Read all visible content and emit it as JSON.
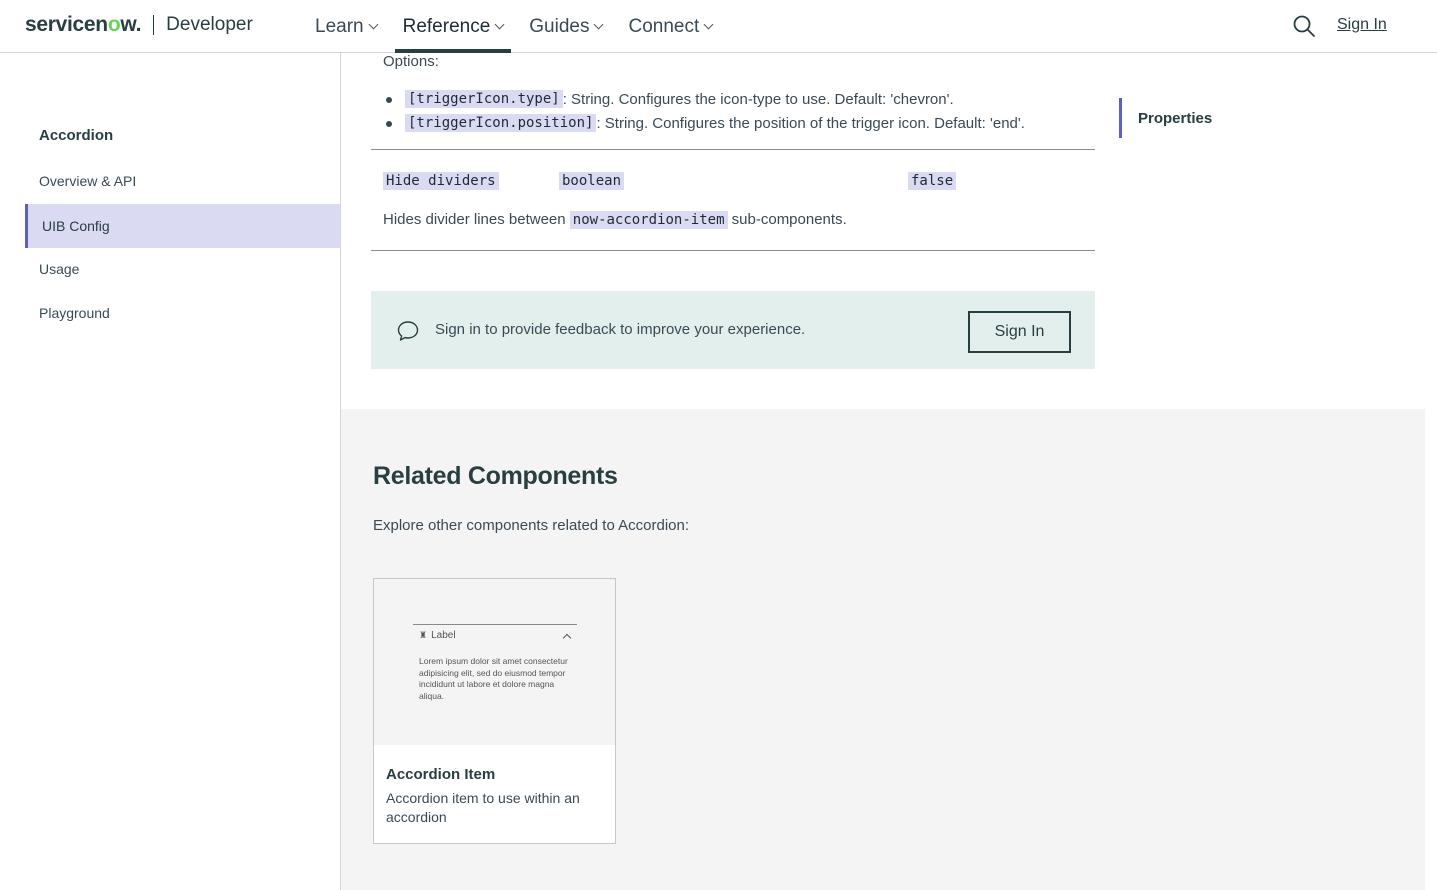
{
  "header": {
    "brand_prefix": "servicen",
    "brand_o": "o",
    "brand_suffix": "w.",
    "product": "Developer",
    "nav": [
      {
        "label": "Learn"
      },
      {
        "label": "Reference"
      },
      {
        "label": "Guides"
      },
      {
        "label": "Connect"
      }
    ],
    "active_nav": "Reference",
    "sign_in": "Sign In",
    "icons": {
      "search": "search-icon",
      "chevron": "chevron-down-icon"
    }
  },
  "sidebar": {
    "title": "Accordion",
    "items": [
      {
        "label": "Overview & API"
      },
      {
        "label": "UIB Config"
      },
      {
        "label": "Usage"
      },
      {
        "label": "Playground"
      }
    ],
    "active": "UIB Config"
  },
  "content": {
    "options_label": "Options:",
    "bullets": [
      {
        "code": "[triggerIcon.type]",
        "text": ": String. Configures the icon-type to use. Default: 'chevron'."
      },
      {
        "code": "[triggerIcon.position]",
        "text": ": String. Configures the position of the trigger icon. Default: 'end'."
      }
    ],
    "property": {
      "name": "Hide dividers",
      "type": "boolean",
      "default": "false",
      "desc_before": "Hides divider lines between ",
      "desc_code": "now-accordion-item",
      "desc_after": " sub-components."
    },
    "feedback": {
      "text": "Sign in to provide feedback to improve your experience.",
      "button": "Sign In",
      "icon": "chat-bubble-icon"
    }
  },
  "related": {
    "title": "Related Components",
    "subtitle": "Explore other components related to Accordion:",
    "cards": [
      {
        "title": "Accordion Item",
        "description": "Accordion item to use within an accordion",
        "thumb_label": "Label",
        "thumb_body": "Lorem ipsum dolor sit amet consectetur adipisicing elit, sed do eiusmod tempor incididunt ut labore et dolore magna aliqua."
      }
    ]
  },
  "toc": {
    "items": [
      {
        "label": "Properties"
      }
    ]
  },
  "colors": {
    "accent": "#5b5fc7",
    "active_bg": "#dadbf2",
    "brand_dark": "#293e40",
    "brand_green": "#62d84e",
    "feedback_bg": "#e3efec"
  }
}
